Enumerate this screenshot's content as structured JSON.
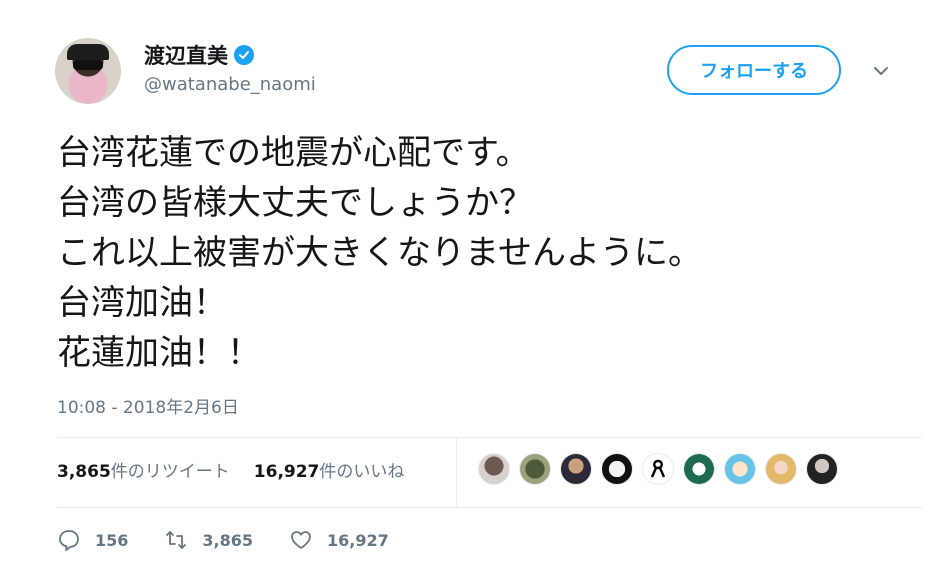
{
  "user": {
    "name": "渡辺直美",
    "handle": "@watanabe_naomi",
    "follow_label": "フォローする"
  },
  "tweet": {
    "lines": [
      "台湾花蓮での地震が心配です。",
      "台湾の皆様大丈夫でしょうか？",
      "これ以上被害が大きくなりませんように。",
      "台湾加油！",
      "花蓮加油！！"
    ],
    "timestamp": "10:08 - 2018年2月6日"
  },
  "stats": {
    "retweets_count": "3,865",
    "retweets_label": "件のリツイート",
    "likes_count": "16,927",
    "likes_label": "件のいいね"
  },
  "actions": {
    "reply_count": "156",
    "retweet_count": "3,865",
    "like_count": "16,927"
  },
  "colors": {
    "accent": "#1da1f2",
    "text": "#14171a",
    "muted": "#657786"
  },
  "icons": [
    "verified-badge-icon",
    "chevron-down-icon",
    "reply-icon",
    "retweet-icon",
    "heart-icon"
  ]
}
